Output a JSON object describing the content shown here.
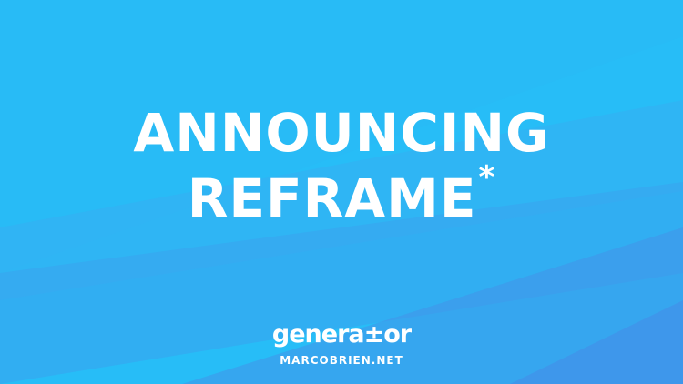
{
  "headline": {
    "line1": "ANNOUNCING",
    "line2": "REFRAME",
    "mark": "*"
  },
  "brand": {
    "logo": "genera±or",
    "site": "MARCOBRIEN.NET"
  },
  "colors": {
    "background": "#27bdf7",
    "stripe_light": "#2fb6f5",
    "stripe_mid": "#3aa3ee",
    "stripe_deep": "#4690e8",
    "text": "#ffffff"
  }
}
